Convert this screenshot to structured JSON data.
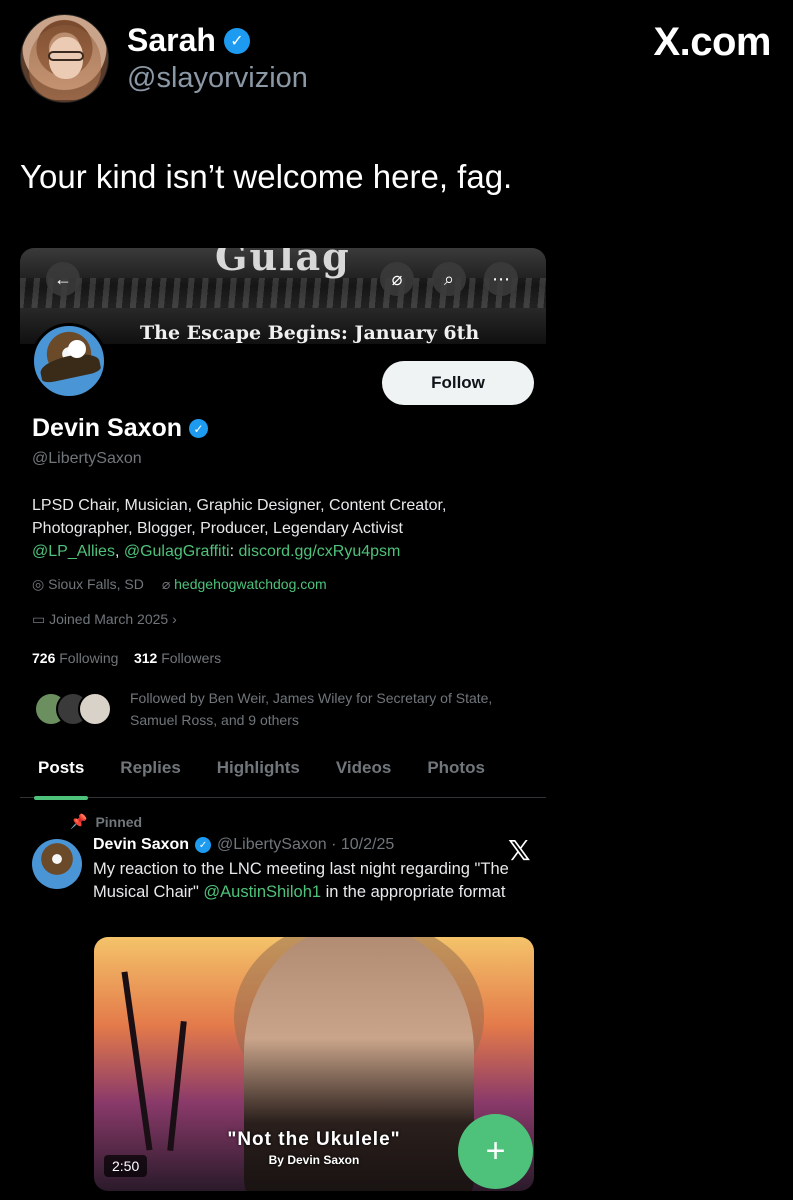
{
  "outer_tweet": {
    "author_name": "Sarah",
    "author_handle": "@slayorvizion",
    "site_label": "X.com",
    "text": "Your kind isn’t welcome here, fag."
  },
  "profile": {
    "banner_title": "Gulag",
    "banner_tagline": "The Escape Begins: January 6th",
    "back_icon": "←",
    "follow_label": "Follow",
    "name": "Devin Saxon",
    "handle": "@LibertySaxon",
    "bio_line1": "LPSD Chair, Musician, Graphic Designer, Content Creator,",
    "bio_line2": "Photographer, Blogger, Producer, Legendary Activist",
    "bio_link1": "@LP_Allies",
    "bio_sep": ", ",
    "bio_link2": "@GulagGraffiti",
    "bio_colon": ": ",
    "bio_link3": "discord.gg/cxRyu4psm",
    "location": "Sioux Falls, SD",
    "website": "hedgehogwatchdog.com",
    "joined": "Joined March 2025",
    "following_count": "726",
    "following_label": " Following",
    "followers_count": "312",
    "followers_label": " Followers",
    "followed_by": "Followed by Ben Weir, James Wiley for Secretary of State, Samuel Ross, and 9 others",
    "tabs": [
      "Posts",
      "Replies",
      "Highlights",
      "Videos",
      "Photos"
    ]
  },
  "pinned_post": {
    "pinned_label": "Pinned",
    "author_name": "Devin Saxon",
    "author_handle": "@LibertySaxon · 10/2/25",
    "text_before": "My reaction to the LNC meeting last night regarding \"The Musical Chair\" ",
    "mention": "@AustinShiloh1",
    "text_after": " in the appropriate format",
    "video_title": "\"Not the Ukulele\"",
    "video_subtitle": "By Devin Saxon",
    "video_duration": "2:50",
    "fab_icon": "+"
  },
  "colors": {
    "accent": "#4ec27a",
    "verified": "#1d9bf0",
    "muted": "#71767b"
  }
}
